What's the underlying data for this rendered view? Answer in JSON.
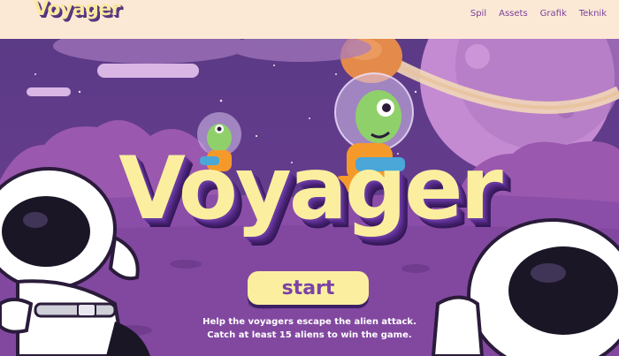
{
  "header": {
    "logo": "Voyager",
    "nav": [
      "Spil",
      "Assets",
      "Grafik",
      "Teknik"
    ]
  },
  "hero": {
    "title": "Voyager",
    "start_label": "start",
    "instructions_line1": "Help the voyagers escape the alien attack.",
    "instructions_line2": "Catch at least 15 aliens to win the game."
  },
  "colors": {
    "topbar": "#fbe9d5",
    "sky": "#6a3d8f",
    "title_yellow": "#fbef9f",
    "title_shadow": "#4b2478",
    "alien_green": "#8fd06b",
    "suit_orange": "#f59a2a",
    "nav_text": "#7a3f9c"
  }
}
